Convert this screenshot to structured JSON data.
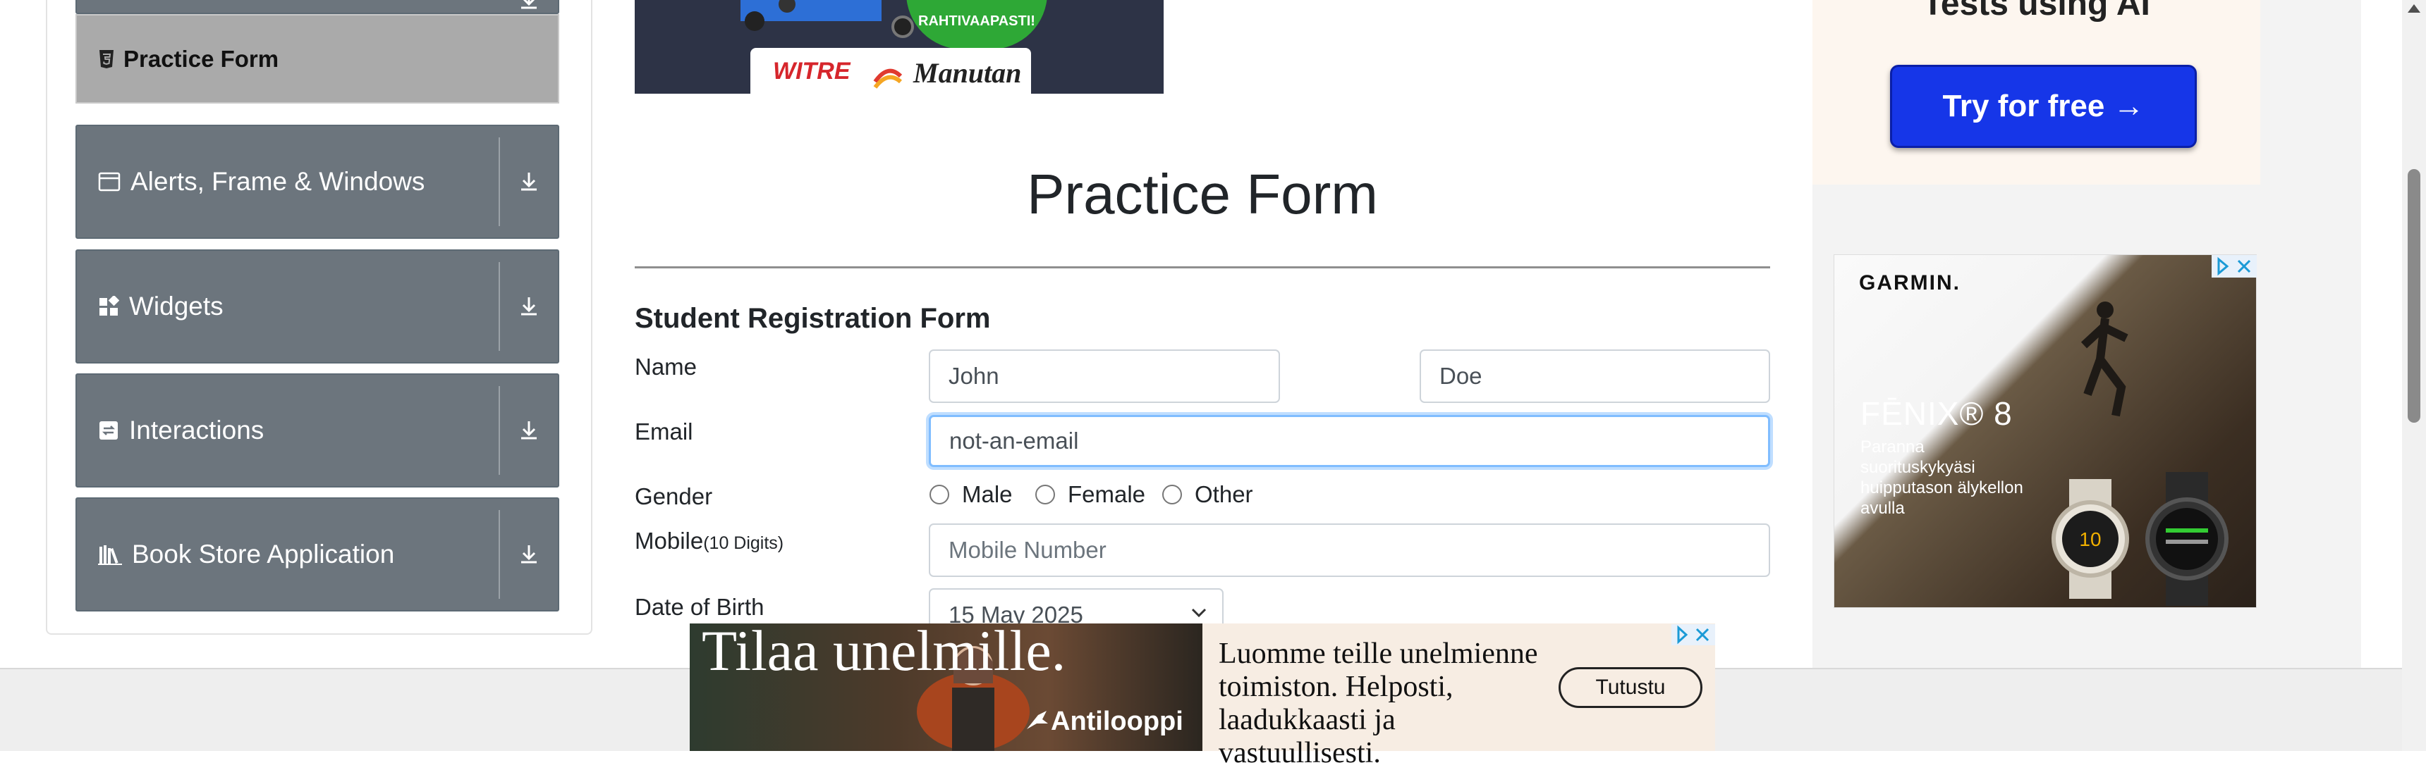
{
  "sidebar": {
    "active_item": "Practice Form",
    "groups": [
      {
        "label": "Alerts, Frame & Windows",
        "icon": "window-icon"
      },
      {
        "label": "Widgets",
        "icon": "widgets-icon"
      },
      {
        "label": "Interactions",
        "icon": "interactions-icon"
      },
      {
        "label": "Book Store Application",
        "icon": "books-icon"
      }
    ]
  },
  "main": {
    "page_title": "Practice Form",
    "form_heading": "Student Registration Form",
    "name_label": "Name",
    "first_name_value": "John",
    "last_name_value": "Doe",
    "email_label": "Email",
    "email_value": "not-an-email",
    "gender_label": "Gender",
    "gender_options": [
      "Male",
      "Female",
      "Other"
    ],
    "mobile_label": "Mobile",
    "mobile_hint": "(10 Digits)",
    "mobile_placeholder": "Mobile Number",
    "dob_label": "Date of Birth",
    "dob_value": "15 May 2025"
  },
  "ads": {
    "top_banner": {
      "brand": "WITRE",
      "partner": "Manutan",
      "badge": "RAHTIVAAPASTI!"
    },
    "right_top": {
      "text": "Tests using AI",
      "button": "Try for free →"
    },
    "right_garmin": {
      "brand": "GARMIN.",
      "product": "FĒNIX® 8",
      "text": "Paranna suorituskykyäsi huipputason älykellon avulla"
    },
    "bottom": {
      "headline": "Tilaa unelmille.",
      "brand": "Antilooppi",
      "text": "Luomme teille unelmienne toimiston. Helposti, laadukkaasti ja vastuullisesti.",
      "button": "Tutustu"
    }
  },
  "colors": {
    "sidebar_group": "#6c757d",
    "sidebar_active": "#aaaaaa",
    "input_focus": "#80bdff",
    "cta_blue": "#1636e8"
  }
}
